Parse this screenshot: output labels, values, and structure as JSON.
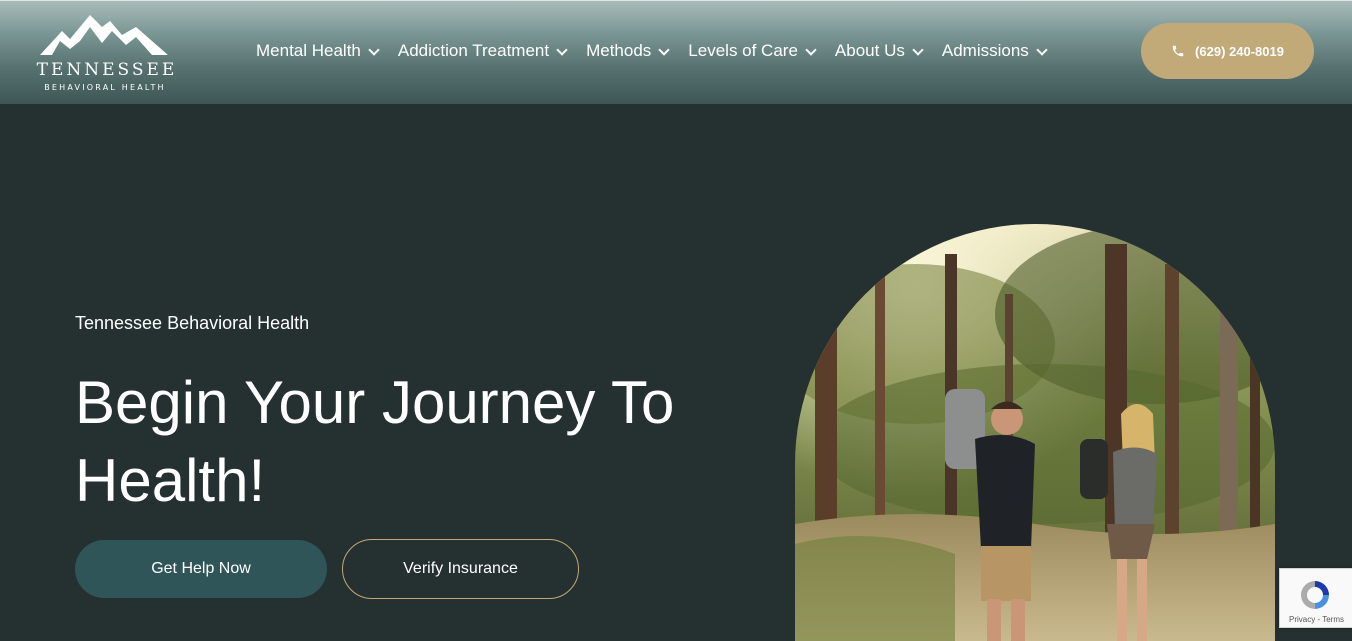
{
  "brand": {
    "name": "TENNESSEE",
    "subtitle": "BEHAVIORAL HEALTH"
  },
  "nav": {
    "items": [
      {
        "label": "Mental Health"
      },
      {
        "label": "Addiction Treatment"
      },
      {
        "label": "Methods"
      },
      {
        "label": "Levels of Care"
      },
      {
        "label": "About Us"
      },
      {
        "label": "Admissions"
      }
    ]
  },
  "header": {
    "phone": "(629) 240-8019"
  },
  "hero": {
    "eyebrow": "Tennessee Behavioral Health",
    "headline_line1": "Begin Your Journey To",
    "headline_line2": "Health!",
    "primary_cta": "Get Help Now",
    "secondary_cta": "Verify Insurance"
  },
  "recaptcha": {
    "text": "Privacy - Terms"
  },
  "colors": {
    "background": "#253030",
    "accent_gold": "#c2a978",
    "primary_button": "#2f5558"
  }
}
